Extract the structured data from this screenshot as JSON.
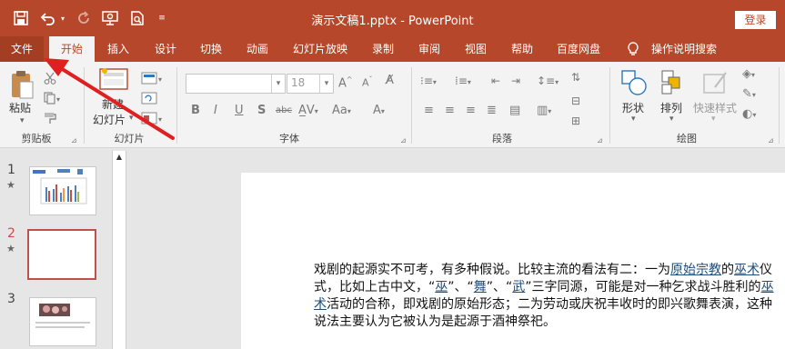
{
  "window": {
    "title": "演示文稿1.pptx  -  PowerPoint",
    "login_label": "登录"
  },
  "quick_access": {
    "save_icon": "save-icon",
    "undo_icon": "undo-icon",
    "redo_icon": "redo-icon",
    "present_icon": "slideshow-icon",
    "preview_icon": "print-preview-icon",
    "customize_icon": "customize-icon"
  },
  "tabs": [
    "文件",
    "开始",
    "插入",
    "设计",
    "切换",
    "动画",
    "幻灯片放映",
    "录制",
    "审阅",
    "视图",
    "帮助",
    "百度网盘"
  ],
  "tell_me": "操作说明搜索",
  "ribbon": {
    "clipboard": {
      "paste_label": "粘贴",
      "group_label": "剪贴板"
    },
    "slides": {
      "new_slide_line1": "新建",
      "new_slide_line2": "幻灯片",
      "group_label": "幻灯片"
    },
    "font": {
      "font_size": "18",
      "group_label": "字体"
    },
    "paragraph": {
      "group_label": "段落"
    },
    "drawing": {
      "shapes_label": "形状",
      "arrange_label": "排列",
      "quick_styles_label": "快速样式",
      "group_label": "绘图"
    }
  },
  "slides_panel": [
    {
      "number": "1",
      "star": "★"
    },
    {
      "number": "2",
      "star": "★"
    },
    {
      "number": "3",
      "star": ""
    }
  ],
  "slide_content": {
    "p1": "戏剧的起源实不可考，有多种假说。比较主流的看法有二：一为",
    "link1": "原始宗教",
    "p2": "的",
    "link2": "巫术",
    "p3": "仪式，比如上古中文，“",
    "link3": "巫",
    "p4": "”、“",
    "link4": "舞",
    "p5": "”、“",
    "link5": "武",
    "p6": "”三字同源，可能是对一种乞求战斗胜利的",
    "link6": "巫术",
    "p7": "活动的合称，即戏剧的原始形态；二为劳动或庆祝丰收时的即兴歌舞表演，这种说法主要认为它被认为是起源于酒神祭祀。"
  },
  "colors": {
    "accent": "#b7472a",
    "annotation_arrow": "#e02020"
  }
}
